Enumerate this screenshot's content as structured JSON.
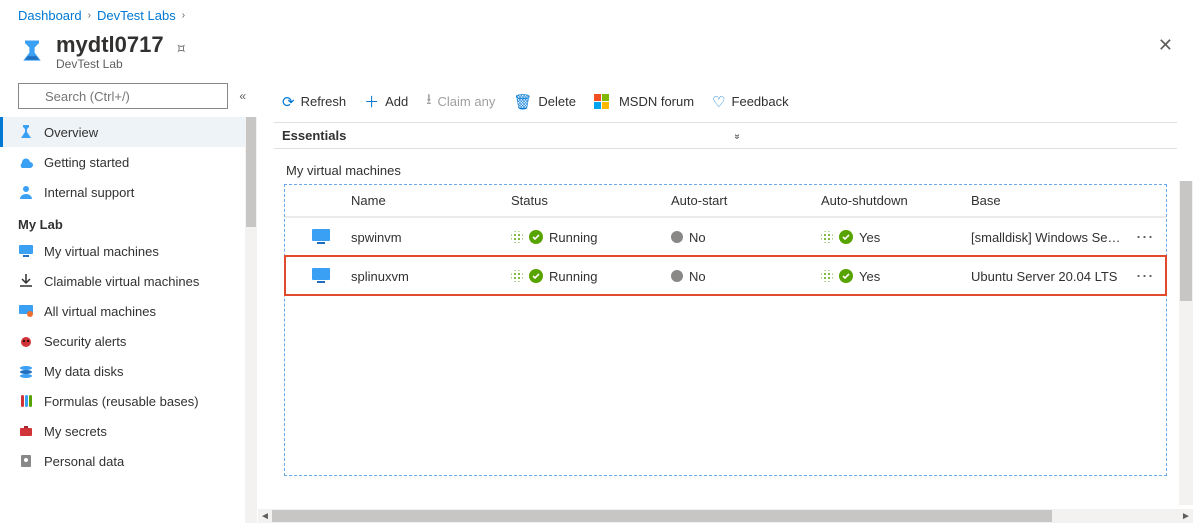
{
  "breadcrumb": [
    {
      "label": "Dashboard"
    },
    {
      "label": "DevTest Labs"
    }
  ],
  "header": {
    "title": "mydtl0717",
    "subtype": "DevTest Lab"
  },
  "search": {
    "placeholder": "Search (Ctrl+/)"
  },
  "sidebar": {
    "primary": [
      {
        "label": "Overview",
        "icon": "flask",
        "active": true
      },
      {
        "label": "Getting started",
        "icon": "cloud-download"
      },
      {
        "label": "Internal support",
        "icon": "person-headset"
      }
    ],
    "section": "My Lab",
    "mylab": [
      {
        "label": "My virtual machines",
        "icon": "vm"
      },
      {
        "label": "Claimable virtual machines",
        "icon": "download-arrow"
      },
      {
        "label": "All virtual machines",
        "icon": "vm-all"
      },
      {
        "label": "Security alerts",
        "icon": "ladybug"
      },
      {
        "label": "My data disks",
        "icon": "disks"
      },
      {
        "label": "Formulas (reusable bases)",
        "icon": "test-tubes"
      },
      {
        "label": "My secrets",
        "icon": "briefcase-red"
      },
      {
        "label": "Personal data",
        "icon": "phonebook"
      }
    ]
  },
  "toolbar": {
    "refresh": "Refresh",
    "add": "Add",
    "claim_any": "Claim any",
    "delete": "Delete",
    "msdn": "MSDN forum",
    "feedback": "Feedback"
  },
  "essentials_label": "Essentials",
  "vm_section_label": "My virtual machines",
  "vm_columns": {
    "name": "Name",
    "status": "Status",
    "autostart": "Auto-start",
    "autoshutdown": "Auto-shutdown",
    "base": "Base"
  },
  "vms": [
    {
      "name": "spwinvm",
      "status": "Running",
      "autostart_label": "No",
      "autoshutdown_label": "Yes",
      "base": "[smalldisk] Windows Se…",
      "highlight": false
    },
    {
      "name": "splinuxvm",
      "status": "Running",
      "autostart_label": "No",
      "autoshutdown_label": "Yes",
      "base": "Ubuntu Server 20.04 LTS",
      "highlight": true
    }
  ]
}
